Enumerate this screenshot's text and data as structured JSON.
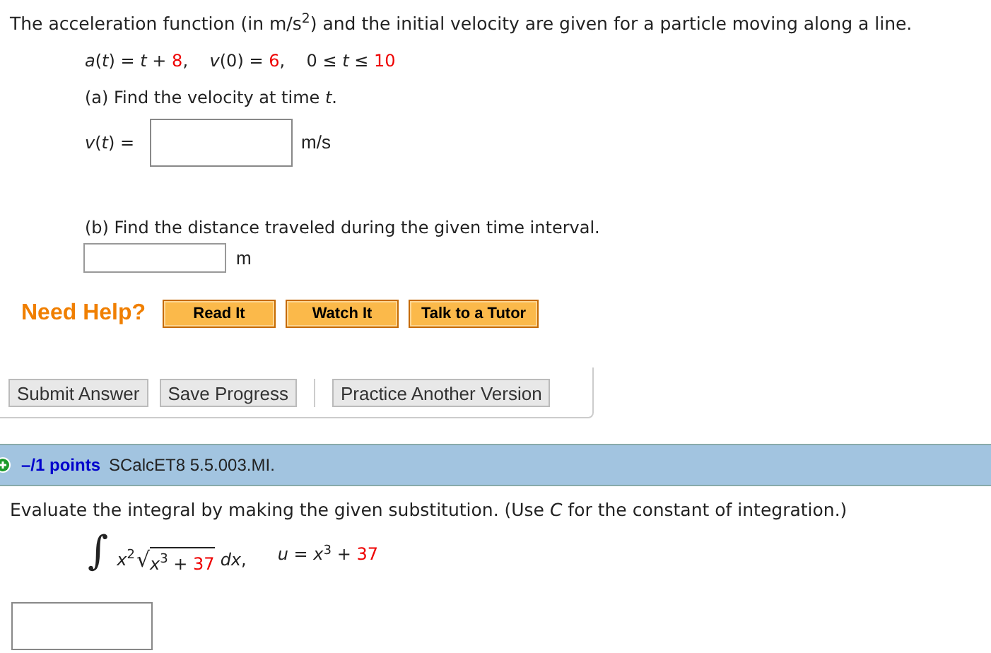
{
  "question_1": {
    "intro": "The acceleration function (in m/s$^{2}$) and the initial velocity are given for a particle moving along a line.",
    "given": [
      {
        "text": "*a*(*t*) = *t* + ",
        "highlighted": false
      },
      {
        "text": "8",
        "highlighted": true
      },
      {
        "text": ",    *v*(0) = ",
        "highlighted": false
      },
      {
        "text": "6",
        "highlighted": true
      },
      {
        "text": ",    0 ≤ *t* ≤ ",
        "highlighted": false
      },
      {
        "text": "10",
        "highlighted": true
      }
    ],
    "parts": [
      {
        "prompt": "(a) Find the velocity at time *t*.",
        "label": "*v*(*t*) =",
        "unit": "m/s"
      },
      {
        "prompt": "(b) Find the distance traveled during the given time interval.",
        "unit": "m"
      }
    ],
    "help": {
      "title": "Need Help?",
      "buttons": [
        "Read It",
        "Watch It",
        "Talk to a Tutor"
      ]
    },
    "actions": [
      "Submit Answer",
      "Save Progress",
      "Practice Another Version"
    ]
  },
  "question_2": {
    "points": "–/1 points",
    "code": "SCalcET8 5.5.003.MI.",
    "instruction": "Evaluate the integral by making the given substitution. (Use *C* for the constant of integration.)",
    "integral": {
      "sign": "∫",
      "factor": "*x*$^{2}$",
      "radical": "√",
      "radicand": [
        {
          "text": "*x*$^{3}$ + ",
          "highlighted": false
        },
        {
          "text": "37",
          "highlighted": true
        }
      ],
      "differential": "*dx*,",
      "substitution": [
        {
          "text": "*u* = *x*$^{3}$ + ",
          "highlighted": false
        },
        {
          "text": "37",
          "highlighted": true
        }
      ]
    }
  }
}
